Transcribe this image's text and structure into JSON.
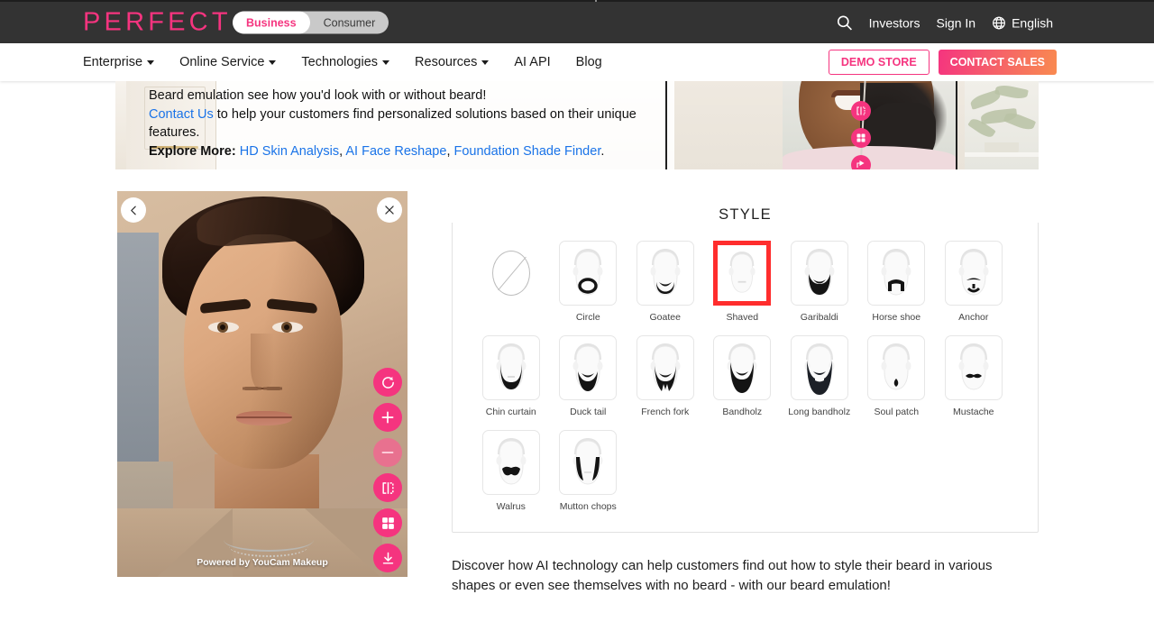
{
  "topbar": {
    "logo": "PERFECT",
    "segments": [
      {
        "label": "Business",
        "active": true
      },
      {
        "label": "Consumer",
        "active": false
      }
    ],
    "search_icon": "search-icon",
    "links": [
      {
        "label": "Investors"
      },
      {
        "label": "Sign In"
      }
    ],
    "language": {
      "icon": "globe-icon",
      "label": "English"
    }
  },
  "nav": {
    "items": [
      {
        "label": "Enterprise",
        "has_dropdown": true
      },
      {
        "label": "Online Service",
        "has_dropdown": true
      },
      {
        "label": "Technologies",
        "has_dropdown": true
      },
      {
        "label": "Resources",
        "has_dropdown": true
      },
      {
        "label": "AI API",
        "has_dropdown": false
      },
      {
        "label": "Blog",
        "has_dropdown": false
      }
    ],
    "demo_store_label": "DEMO STORE",
    "contact_sales_label": "CONTACT SALES"
  },
  "banner": {
    "line1": "Beard emulation see how you'd look with or without beard!",
    "contact_link": "Contact Us",
    "line2_rest": " to help your customers find personalized solutions based on their unique features.",
    "explore_label": "Explore More:",
    "explore_links": [
      "HD Skin Analysis",
      "AI Face Reshape",
      "Foundation Shade Finder"
    ],
    "explore_sep": ", ",
    "explore_end": ".",
    "fabs": [
      "compare-icon",
      "grid-icon",
      "share-icon"
    ]
  },
  "photo": {
    "back_icon": "chevron-left-icon",
    "close_icon": "close-icon",
    "watermark": "Powered by YouCam Makeup",
    "tools": [
      {
        "name": "reset-icon",
        "label": "Reset",
        "disabled": false
      },
      {
        "name": "zoom-in-icon",
        "label": "Zoom in",
        "disabled": false
      },
      {
        "name": "zoom-out-icon",
        "label": "Zoom out",
        "disabled": true
      },
      {
        "name": "compare-icon",
        "label": "Compare",
        "disabled": false
      },
      {
        "name": "grid-icon",
        "label": "Grid",
        "disabled": false
      },
      {
        "name": "download-icon",
        "label": "Download",
        "disabled": false
      }
    ]
  },
  "style_panel": {
    "title": "STYLE",
    "selected": "Shaved",
    "selection_color": "#FF2D2D",
    "items": [
      {
        "label": "",
        "kind": "none"
      },
      {
        "label": "Circle",
        "kind": "circle"
      },
      {
        "label": "Goatee",
        "kind": "goatee"
      },
      {
        "label": "Shaved",
        "kind": "shaved"
      },
      {
        "label": "Garibaldi",
        "kind": "garibaldi"
      },
      {
        "label": "Horse shoe",
        "kind": "horseshoe"
      },
      {
        "label": "Anchor",
        "kind": "anchor"
      },
      {
        "label": "Chin curtain",
        "kind": "chincurtain"
      },
      {
        "label": "Duck tail",
        "kind": "ducktail"
      },
      {
        "label": "French fork",
        "kind": "frenchfork"
      },
      {
        "label": "Bandholz",
        "kind": "bandholz"
      },
      {
        "label": "Long bandholz",
        "kind": "longbandholz"
      },
      {
        "label": "Soul patch",
        "kind": "soulpatch"
      },
      {
        "label": "Mustache",
        "kind": "mustache"
      },
      {
        "label": "Walrus",
        "kind": "walrus"
      },
      {
        "label": "Mutton chops",
        "kind": "muttonchops"
      }
    ]
  },
  "description": "Discover how AI technology can help customers find out how to style their beard in various shapes or even see themselves with no beard - with our beard emulation!",
  "colors": {
    "brand_pink": "#F5347F",
    "topbar_bg": "#333333",
    "link_blue": "#1a73e8",
    "selection_red": "#FF2D2D"
  }
}
